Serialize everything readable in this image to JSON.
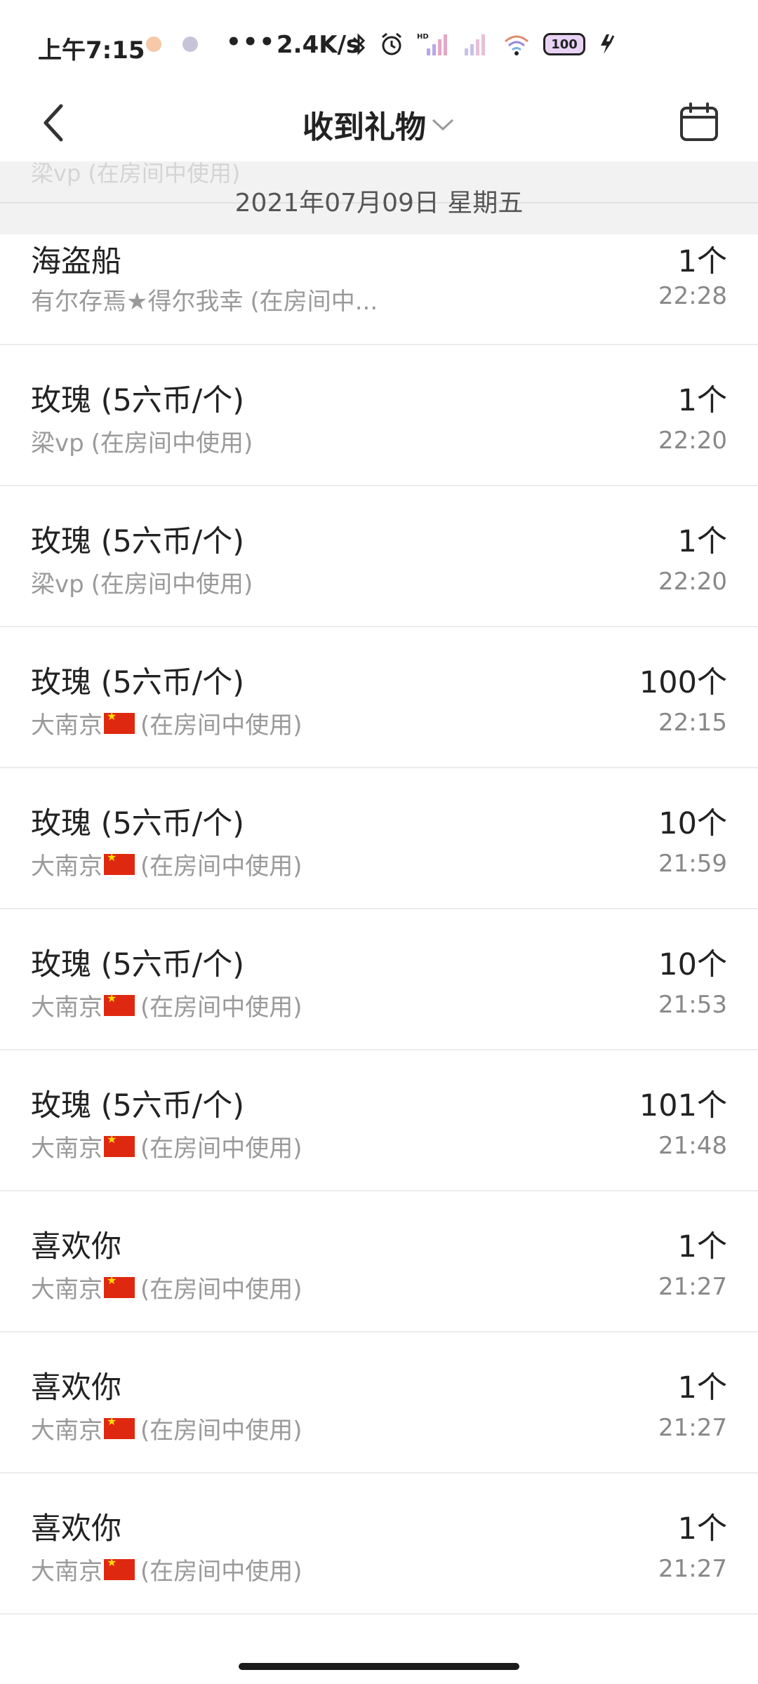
{
  "status_bar": {
    "time": "上午7:15",
    "dots": "•••",
    "speed": "2.4K/s",
    "battery": "100"
  },
  "nav": {
    "title": "收到礼物"
  },
  "date_header": {
    "date": "2021年07月09日 星期五",
    "ghost_text": "梁vp (在房间中使用)"
  },
  "gifts": [
    {
      "name": "海盗船",
      "sender": "有尔存焉★得尔我幸",
      "suffix": "(在房间中...",
      "flag": false,
      "qty": "1个",
      "time": "22:28"
    },
    {
      "name": "玫瑰 (5六币/个)",
      "sender": "梁vp",
      "suffix": "(在房间中使用)",
      "flag": false,
      "qty": "1个",
      "time": "22:20"
    },
    {
      "name": "玫瑰 (5六币/个)",
      "sender": "梁vp",
      "suffix": "(在房间中使用)",
      "flag": false,
      "qty": "1个",
      "time": "22:20"
    },
    {
      "name": "玫瑰 (5六币/个)",
      "sender": "大南京",
      "suffix": "(在房间中使用)",
      "flag": true,
      "qty": "100个",
      "time": "22:15"
    },
    {
      "name": "玫瑰 (5六币/个)",
      "sender": "大南京",
      "suffix": "(在房间中使用)",
      "flag": true,
      "qty": "10个",
      "time": "21:59"
    },
    {
      "name": "玫瑰 (5六币/个)",
      "sender": "大南京",
      "suffix": "(在房间中使用)",
      "flag": true,
      "qty": "10个",
      "time": "21:53"
    },
    {
      "name": "玫瑰 (5六币/个)",
      "sender": "大南京",
      "suffix": "(在房间中使用)",
      "flag": true,
      "qty": "101个",
      "time": "21:48"
    },
    {
      "name": "喜欢你",
      "sender": "大南京",
      "suffix": "(在房间中使用)",
      "flag": true,
      "qty": "1个",
      "time": "21:27"
    },
    {
      "name": "喜欢你",
      "sender": "大南京",
      "suffix": "(在房间中使用)",
      "flag": true,
      "qty": "1个",
      "time": "21:27"
    },
    {
      "name": "喜欢你",
      "sender": "大南京",
      "suffix": "(在房间中使用)",
      "flag": true,
      "qty": "1个",
      "time": "21:27"
    }
  ],
  "icons": {
    "back": "chevron-left-icon",
    "dropdown": "chevron-down-icon",
    "calendar": "calendar-icon",
    "bluetooth": "bluetooth-icon",
    "alarm": "alarm-icon",
    "signal": "signal-icon",
    "wifi": "wifi-icon",
    "charging": "charging-icon"
  }
}
